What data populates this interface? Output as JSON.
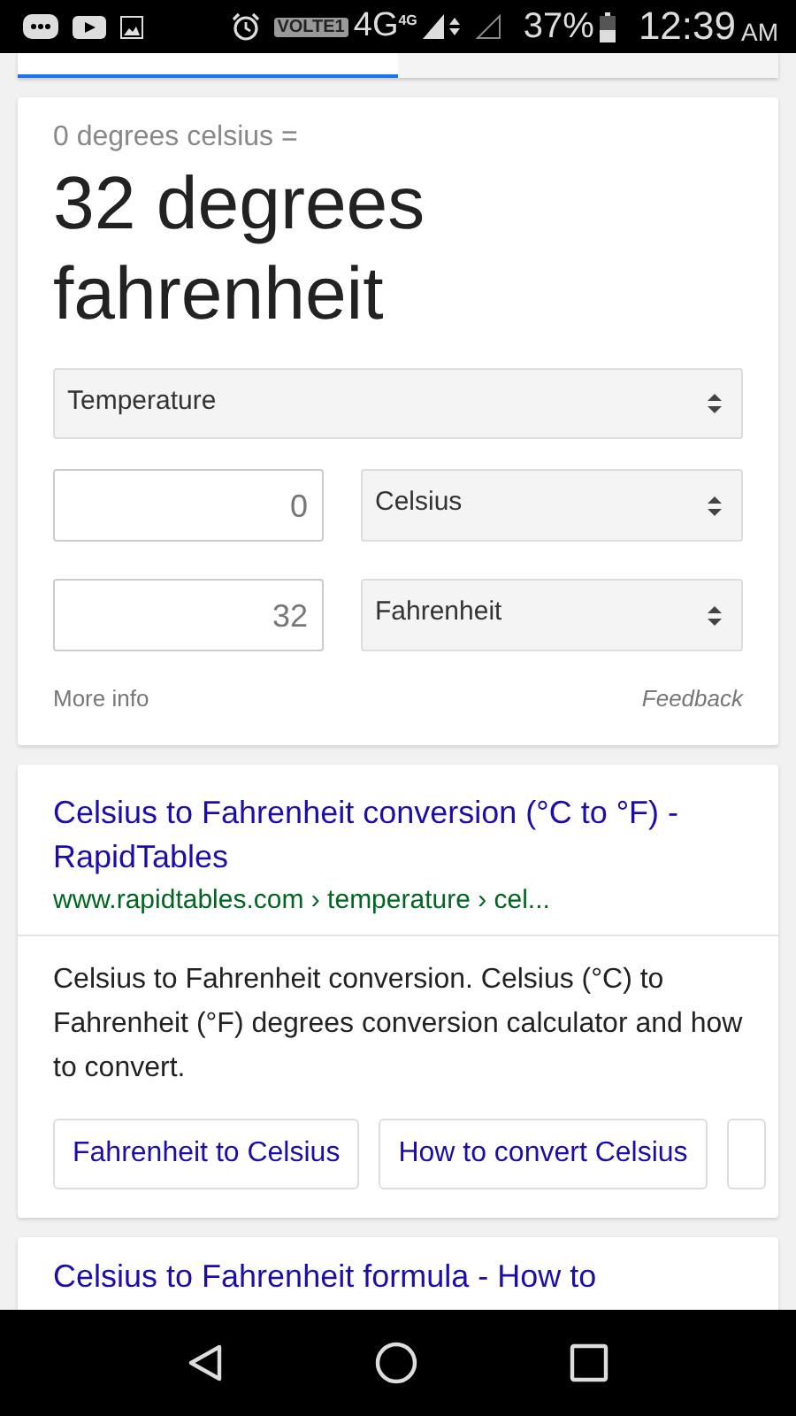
{
  "status_bar": {
    "carrier_tag": "VOLTE1",
    "network": "4G",
    "network_small": "4G",
    "battery": "37%",
    "time": "12:39",
    "meridiem": "AM"
  },
  "converter": {
    "question": "0 degrees celsius =",
    "answer": "32 degrees fahrenheit",
    "category": "Temperature",
    "rows": [
      {
        "value": "0",
        "unit": "Celsius"
      },
      {
        "value": "32",
        "unit": "Fahrenheit"
      }
    ],
    "more_info": "More info",
    "feedback": "Feedback"
  },
  "results": [
    {
      "title": "Celsius to Fahrenheit conversion (°C to °F) - RapidTables",
      "url": "www.rapidtables.com › temperature › cel...",
      "snippet": "Celsius to Fahrenheit conversion. Celsius (°C) to Fahrenheit (°F) degrees conversion calculator and how to convert.",
      "chips": [
        "Fahrenheit to Celsius",
        "How to convert Celsius"
      ]
    },
    {
      "title": "Celsius to Fahrenheit formula - How to"
    }
  ]
}
